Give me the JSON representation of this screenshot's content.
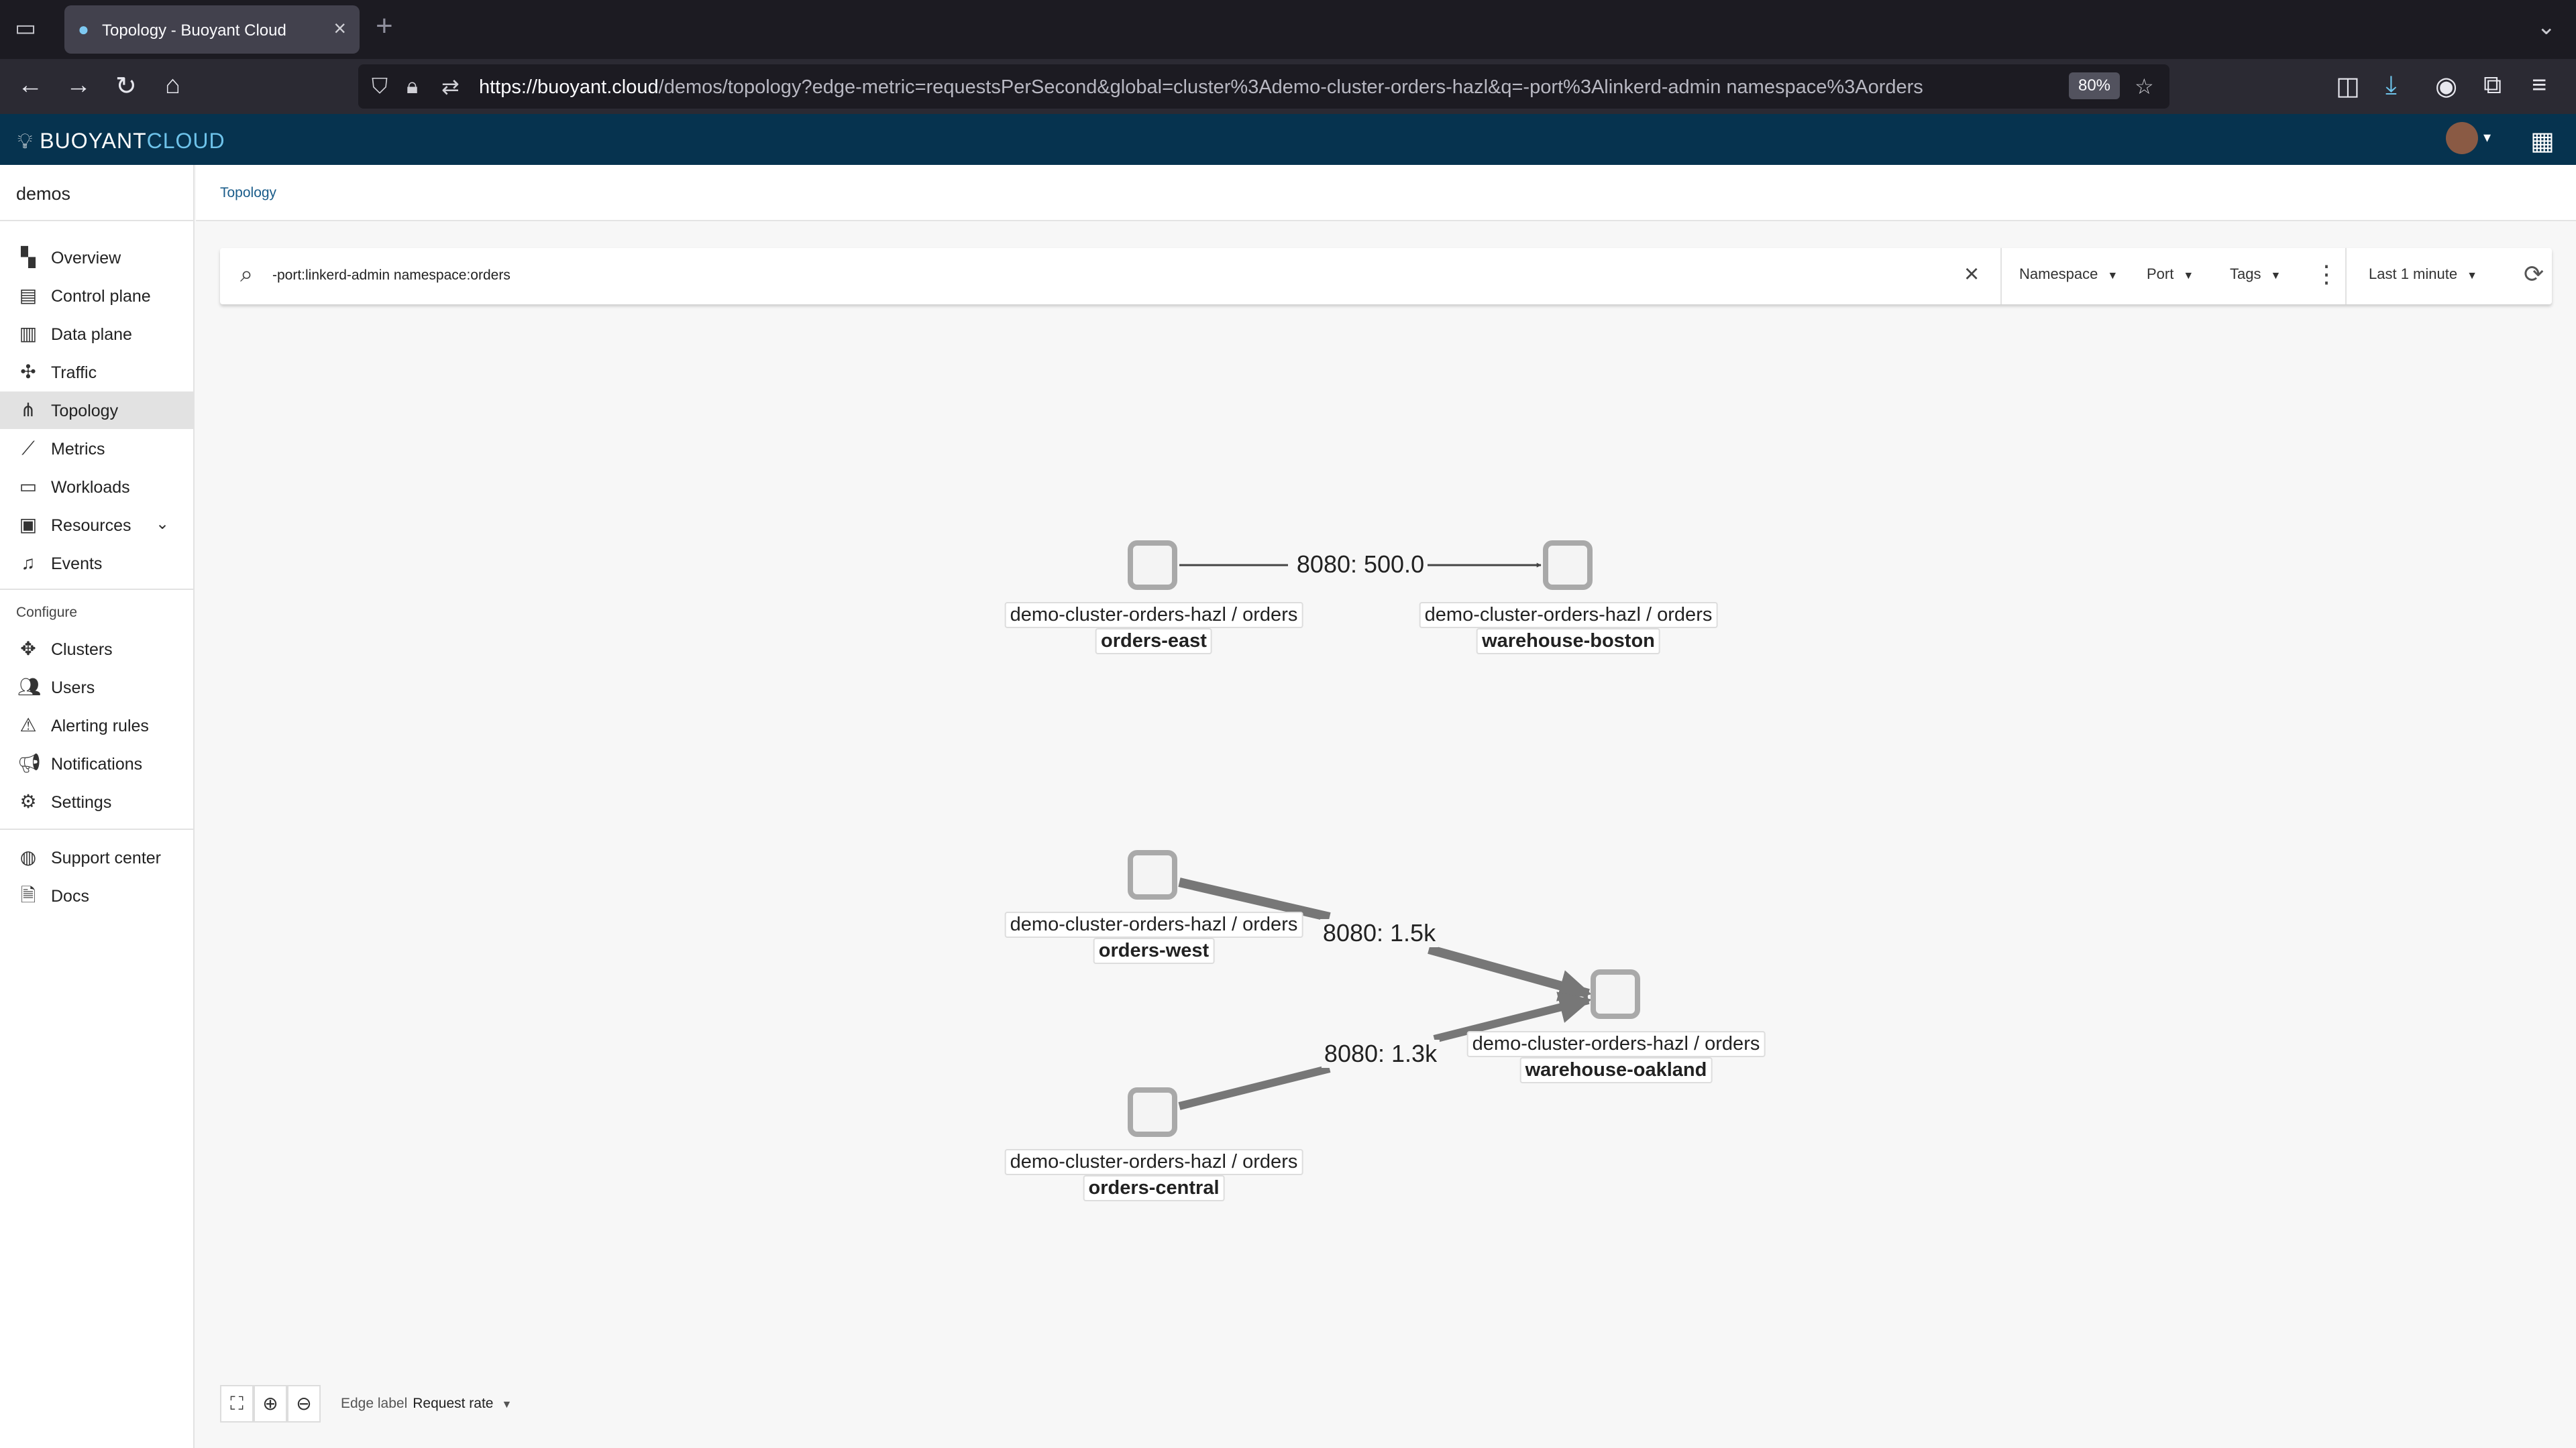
{
  "browser": {
    "tab_title": "Topology - Buoyant Cloud",
    "url_host": "https://buoyant.cloud",
    "url_path": "/demos/topology?edge-metric=requestsPerSecond&global=cluster%3Ademo-cluster-orders-hazl&q=-port%3Alinkerd-admin namespace%3Aorders",
    "zoom": "80%"
  },
  "app": {
    "brand_main": "BUOYANT",
    "brand_sub": "CLOUD"
  },
  "sidebar": {
    "org": "demos",
    "items": [
      {
        "label": "Overview"
      },
      {
        "label": "Control plane"
      },
      {
        "label": "Data plane"
      },
      {
        "label": "Traffic"
      },
      {
        "label": "Topology"
      },
      {
        "label": "Metrics"
      },
      {
        "label": "Workloads"
      },
      {
        "label": "Resources"
      },
      {
        "label": "Events"
      }
    ],
    "configure_heading": "Configure",
    "configure_items": [
      {
        "label": "Clusters"
      },
      {
        "label": "Users"
      },
      {
        "label": "Alerting rules"
      },
      {
        "label": "Notifications"
      },
      {
        "label": "Settings"
      }
    ],
    "support_items": [
      {
        "label": "Support center"
      },
      {
        "label": "Docs"
      }
    ]
  },
  "breadcrumb": "Topology",
  "filter": {
    "query": "-port:linkerd-admin namespace:orders",
    "namespace_label": "Namespace",
    "port_label": "Port",
    "tags_label": "Tags",
    "time_range": "Last 1 minute"
  },
  "topology": {
    "nodes": [
      {
        "namespace": "demo-cluster-orders-hazl / orders",
        "name": "orders-east"
      },
      {
        "namespace": "demo-cluster-orders-hazl / orders",
        "name": "warehouse-boston"
      },
      {
        "namespace": "demo-cluster-orders-hazl / orders",
        "name": "orders-west"
      },
      {
        "namespace": "demo-cluster-orders-hazl / orders",
        "name": "warehouse-oakland"
      },
      {
        "namespace": "demo-cluster-orders-hazl / orders",
        "name": "orders-central"
      }
    ],
    "edges": [
      {
        "label": "8080: 500.0"
      },
      {
        "label": "8080: 1.5k"
      },
      {
        "label": "8080: 1.3k"
      }
    ]
  },
  "bottom": {
    "edge_label_title": "Edge label",
    "edge_label_value": "Request rate"
  }
}
